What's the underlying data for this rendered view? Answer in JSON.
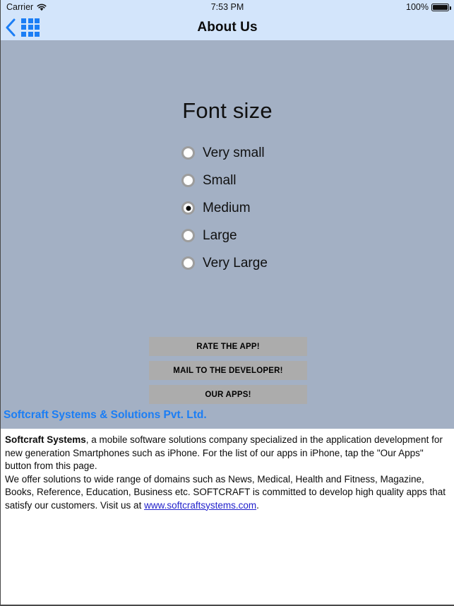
{
  "status_bar": {
    "carrier": "Carrier",
    "wifi_icon": "wifi-icon",
    "time": "7:53 PM",
    "battery_percent": "100%",
    "battery_icon": "battery-full-icon"
  },
  "nav_bar": {
    "back_icon": "back-chevron-icon",
    "grid_icon": "grid-menu-icon",
    "title": "About Us"
  },
  "settings": {
    "section_title": "Font size",
    "options": [
      {
        "label": "Very small",
        "selected": false
      },
      {
        "label": "Small",
        "selected": false
      },
      {
        "label": "Medium",
        "selected": true
      },
      {
        "label": "Large",
        "selected": false
      },
      {
        "label": "Very Large",
        "selected": false
      }
    ]
  },
  "buttons": {
    "rate": "RATE THE APP!",
    "mail": "MAIL TO THE DEVELOPER!",
    "apps": "OUR APPS!"
  },
  "company": {
    "heading": "Softcraft Systems & Solutions Pvt. Ltd."
  },
  "about": {
    "paragraph1_bold": "Softcraft Systems",
    "paragraph1_rest": ", a mobile software solutions company specialized in the application development for new generation Smartphones such as iPhone. For the list of our apps in iPhone, tap the \"Our Apps\" button from this page.",
    "paragraph2_before": "We offer solutions to wide range of domains such as News, Medical, Health and Fitness, Magazine, Books, Reference, Education, Business etc. SOFTCRAFT is committed to develop high quality apps that satisfy our customers. Visit us at ",
    "link_text": "www.softcraftsystems.com",
    "paragraph2_after": "."
  },
  "colors": {
    "nav_background": "#d3e5fb",
    "main_background": "#a3b0c4",
    "accent_blue": "#1b7ef5",
    "button_gray": "#acacac",
    "link_blue": "#2222cc"
  }
}
